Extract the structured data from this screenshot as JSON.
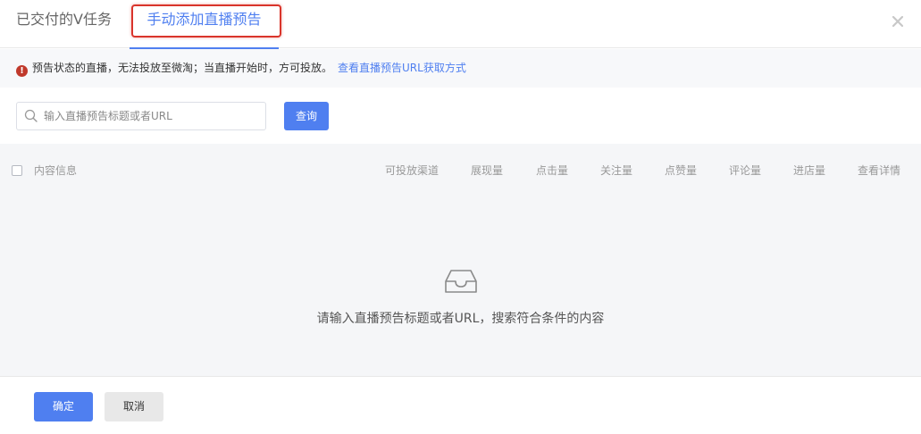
{
  "tabs": {
    "delivered": "已交付的V任务",
    "add_preview": "手动添加直播预告"
  },
  "close_icon": "close-icon",
  "notice": {
    "icon": "warning-icon",
    "icon_color": "#c0392b",
    "text": "预告状态的直播，无法投放至微淘；当直播开始时，方可投放。",
    "link": "查看直播预告URL获取方式"
  },
  "search": {
    "placeholder": "输入直播预告标题或者URL",
    "value": "",
    "button": "查询"
  },
  "table": {
    "columns": [
      "内容信息",
      "可投放渠道",
      "展现量",
      "点击量",
      "关注量",
      "点赞量",
      "评论量",
      "进店量",
      "查看详情"
    ]
  },
  "empty_state": {
    "icon": "inbox-icon",
    "text": "请输入直播预告标题或者URL，搜索符合条件的内容"
  },
  "footer": {
    "confirm": "确定",
    "cancel": "取消"
  },
  "colors": {
    "accent": "#4f7ff0",
    "highlight": "#d9342b"
  }
}
